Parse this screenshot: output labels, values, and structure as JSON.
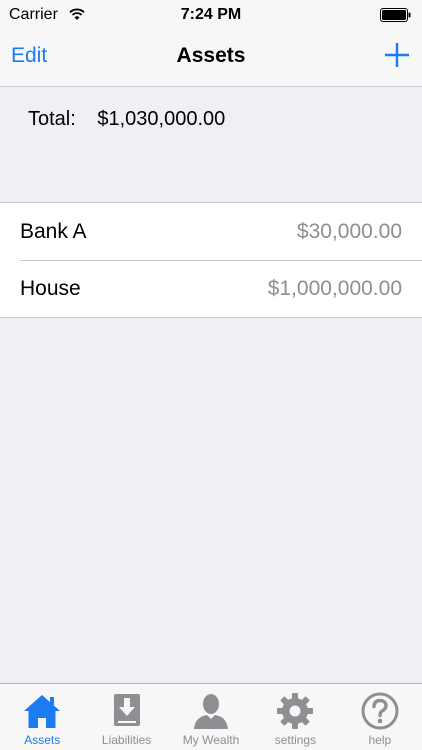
{
  "status_bar": {
    "carrier": "Carrier",
    "time": "7:24 PM"
  },
  "nav": {
    "edit_label": "Edit",
    "title": "Assets",
    "add_icon": "plus-icon"
  },
  "summary": {
    "total_label": "Total:",
    "total_value": "$1,030,000.00"
  },
  "assets": [
    {
      "name": "Bank A",
      "value": "$30,000.00"
    },
    {
      "name": "House",
      "value": "$1,000,000.00"
    }
  ],
  "tabs": [
    {
      "label": "Assets",
      "icon": "house-icon",
      "active": true
    },
    {
      "label": "Liabilities",
      "icon": "download-icon",
      "active": false
    },
    {
      "label": "My Wealth",
      "icon": "person-icon",
      "active": false
    },
    {
      "label": "settings",
      "icon": "gear-icon",
      "active": false
    },
    {
      "label": "help",
      "icon": "question-icon",
      "active": false
    }
  ],
  "colors": {
    "accent": "#1a7cf0",
    "inactive": "#8e8e93",
    "background": "#efeff4"
  }
}
